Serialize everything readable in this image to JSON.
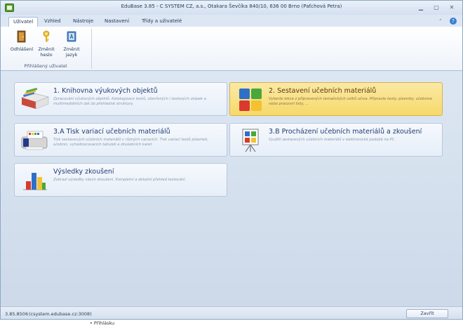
{
  "window": {
    "title": "EduBase 3.85 - C SYSTEM CZ, a.s., Otakara Ševčíka 840/10, 636 00 Brno (Paťchová Petra)",
    "minimize": "▁",
    "maximize": "▢",
    "close": "✕"
  },
  "menu": {
    "tabs": [
      {
        "label": "Uživatel",
        "active": true
      },
      {
        "label": "Vzhled",
        "active": false
      },
      {
        "label": "Nástroje",
        "active": false
      },
      {
        "label": "Nastavení",
        "active": false
      },
      {
        "label": "Třídy a uživatelé",
        "active": false
      }
    ],
    "collapse_glyph": "⌃",
    "help_glyph": "?"
  },
  "ribbon": {
    "buttons": [
      {
        "label": "Odhlášení",
        "icon": "door-icon"
      },
      {
        "label": "Změnit heslo",
        "icon": "key-icon"
      },
      {
        "label": "Změnit jazyk",
        "icon": "book-language-icon"
      }
    ],
    "group_label": "Přihlášený uživatel"
  },
  "cards": [
    {
      "title": "1. Knihovna výukových objektů",
      "desc": "Zpracování výukových objektů. Katalogizace textů, otevřených i testových otázek a multimediálních dat do přehledné struktury.",
      "selected": false,
      "icon": "library-books-icon"
    },
    {
      "title": "2. Sestavení učebních materiálů",
      "desc": "Vyberte lekce z připravených tematických celků učiva. Připravte testy, písemky, učebnice nebo pracovní listy, ...",
      "selected": true,
      "icon": "puzzle-blocks-icon"
    },
    {
      "title": "3.A Tisk variací učebních materiálů",
      "desc": "Tisk sestavených učebních materiálů v různých variacích. Tisk variací testů písemek, učebnic, vyhodnocovacích tabulek a zkušebních karet.",
      "selected": false,
      "icon": "printer-icon"
    },
    {
      "title": "3.B Procházení učebních materiálů a zkoušení",
      "desc": "Využití sestavených učebních materiálů v elektronické podobě na PC.",
      "selected": false,
      "icon": "presentation-board-icon"
    },
    {
      "title": "Výsledky zkoušení",
      "desc": "Zobrazí výsledky všech zkoušení. Kompletní a detailní přehled testování.",
      "selected": false,
      "icon": "bar-chart-icon"
    }
  ],
  "status": {
    "version": "3.85.8506",
    "server": "(csystem.edubase.cz:3008)",
    "close_label": "Zavřít"
  },
  "background_text": "• Přihlásku"
}
